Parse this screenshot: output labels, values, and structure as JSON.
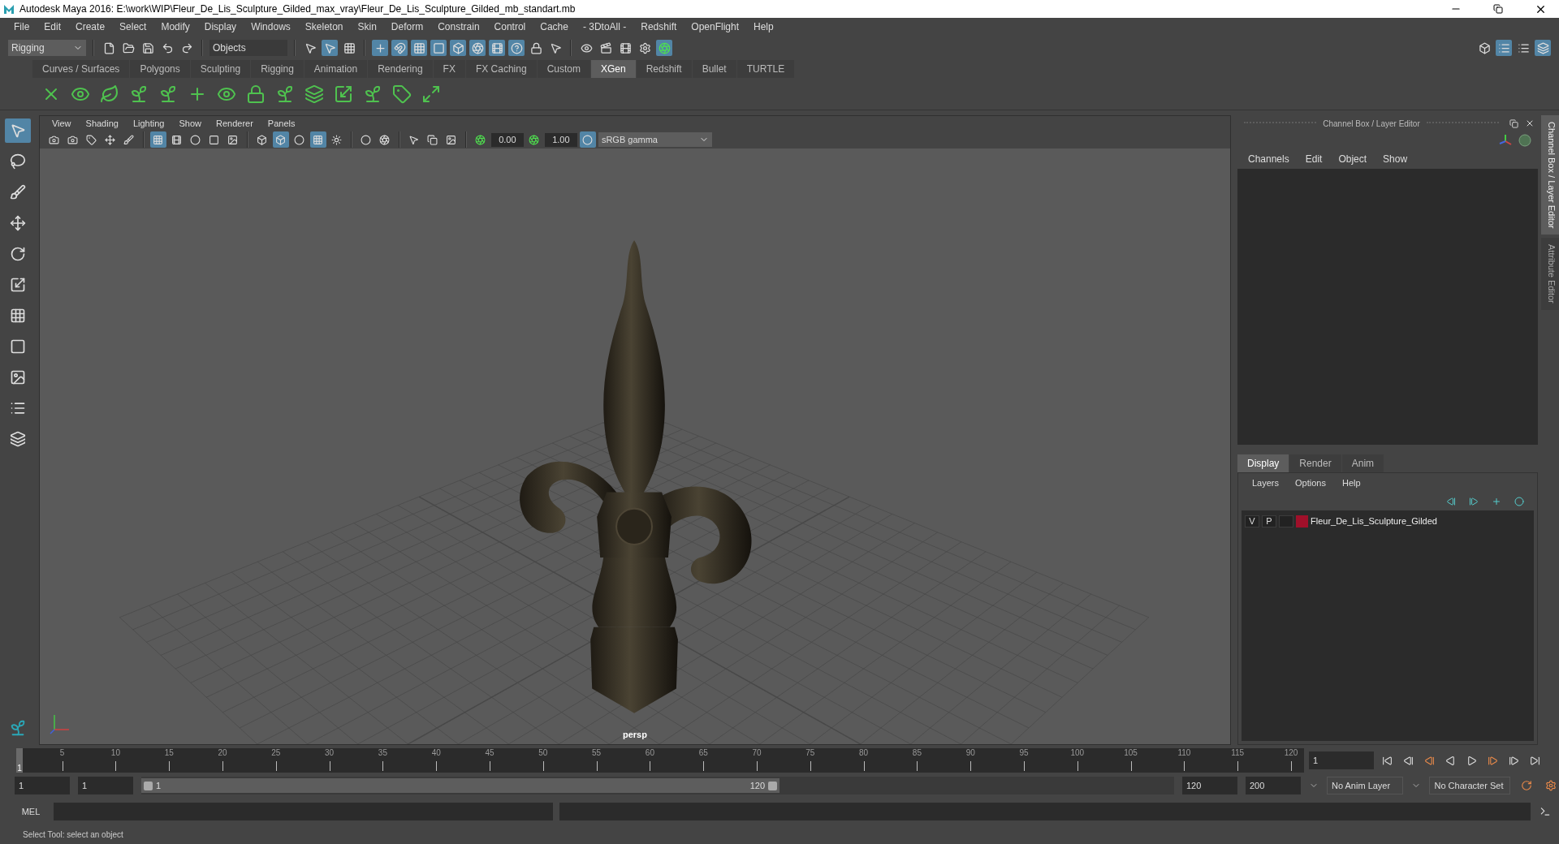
{
  "window": {
    "title": "Autodesk Maya 2016: E:\\work\\WIP\\Fleur_De_Lis_Sculpture_Gilded_max_vray\\Fleur_De_Lis_Sculpture_Gilded_mb_standart.mb"
  },
  "menu_bar": [
    "File",
    "Edit",
    "Create",
    "Select",
    "Modify",
    "Display",
    "Windows",
    "Skeleton",
    "Skin",
    "Deform",
    "Constrain",
    "Control",
    "Cache",
    "- 3DtoAll -",
    "Redshift",
    "OpenFlight",
    "Help"
  ],
  "status_line": {
    "mode": "Rigging",
    "selection_field": "Objects"
  },
  "shelf_tabs": [
    {
      "label": "Curves / Surfaces",
      "selected": false
    },
    {
      "label": "Polygons",
      "selected": false
    },
    {
      "label": "Sculpting",
      "selected": false
    },
    {
      "label": "Rigging",
      "selected": false
    },
    {
      "label": "Animation",
      "selected": false
    },
    {
      "label": "Rendering",
      "selected": false
    },
    {
      "label": "FX",
      "selected": false
    },
    {
      "label": "FX Caching",
      "selected": false
    },
    {
      "label": "Custom",
      "selected": false
    },
    {
      "label": "XGen",
      "selected": true
    },
    {
      "label": "Redshift",
      "selected": false
    },
    {
      "label": "Bullet",
      "selected": false
    },
    {
      "label": "TURTLE",
      "selected": false
    }
  ],
  "viewport": {
    "menu": [
      "View",
      "Shading",
      "Lighting",
      "Show",
      "Renderer",
      "Panels"
    ],
    "exposure": "0.00",
    "gamma": "1.00",
    "color_space": "sRGB gamma",
    "camera_label": "persp"
  },
  "channel_box": {
    "title": "Channel Box / Layer Editor",
    "menu": [
      "Channels",
      "Edit",
      "Object",
      "Show"
    ]
  },
  "layer_editor": {
    "tabs": [
      {
        "label": "Display",
        "selected": true
      },
      {
        "label": "Render",
        "selected": false
      },
      {
        "label": "Anim",
        "selected": false
      }
    ],
    "menu": [
      "Layers",
      "Options",
      "Help"
    ],
    "layers": [
      {
        "visibility": "V",
        "playback": "P",
        "name": "Fleur_De_Lis_Sculpture_Gilded",
        "color": "#a0102a"
      }
    ]
  },
  "side_tabs": [
    {
      "label": "Channel Box / Layer Editor",
      "selected": true
    },
    {
      "label": "Attribute Editor",
      "selected": false
    }
  ],
  "time_slider": {
    "ticks": [
      "5",
      "10",
      "15",
      "20",
      "25",
      "30",
      "35",
      "40",
      "45",
      "50",
      "55",
      "60",
      "65",
      "70",
      "75",
      "80",
      "85",
      "90",
      "95",
      "100",
      "105",
      "110",
      "115",
      "120"
    ],
    "current_frame_marker": "1",
    "level": 0,
    "current_frame": "1"
  },
  "range_slider": {
    "level": 1,
    "start_time": "1",
    "playback_start": "1",
    "range_start": "1",
    "range_end": "120",
    "playback_end": "120",
    "end_time": "200",
    "anim_layer": "No Anim Layer",
    "character_set": "No Character Set"
  },
  "command_line": {
    "language": "MEL"
  },
  "help_line": "Select Tool: select an object"
}
